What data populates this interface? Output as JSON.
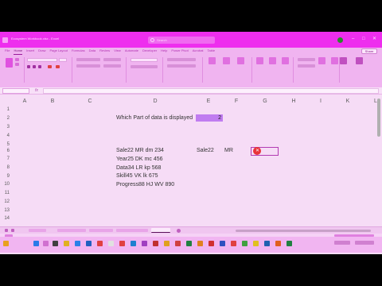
{
  "window": {
    "title": "Ecosystem Workbook.xlsx - Excel",
    "search_placeholder": "Search",
    "controls": [
      "–",
      "□",
      "✕"
    ]
  },
  "ribbon": {
    "tabs": [
      "File",
      "Home",
      "Insert",
      "Draw",
      "Page Layout",
      "Formulas",
      "Data",
      "Review",
      "View",
      "Automate",
      "Developer",
      "Help",
      "Power Pivot",
      "Acrobat",
      "Table"
    ],
    "active_tab": "Home",
    "share_label": "Share"
  },
  "formula_bar": {
    "fx": "fx"
  },
  "sheet": {
    "columns": [
      "A",
      "B",
      "C",
      "D",
      "E",
      "F",
      "G",
      "H",
      "I",
      "K",
      "L"
    ],
    "rows": [
      "1",
      "2",
      "3",
      "4",
      "5",
      "6",
      "7",
      "8",
      "9",
      "10",
      "11",
      "12",
      "13",
      "14"
    ],
    "question_label": "Which Part of data is displayed",
    "selected_value": "2",
    "data_lines": [
      "Sale22 MR dm 234",
      "Year25 DK mc 456",
      "Data34 LR kp 568",
      "Skill45 VK lk 675",
      "Progress88 HJ WV 890"
    ],
    "e6": "Sale22",
    "f6": "MR",
    "g6_icon": "close-icon"
  },
  "accent": "#e8343a"
}
